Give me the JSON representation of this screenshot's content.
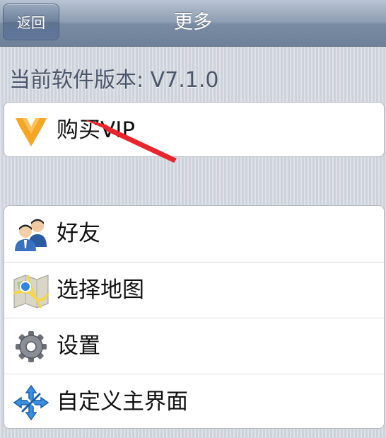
{
  "nav": {
    "back_label": "返回",
    "title": "更多"
  },
  "version": {
    "text": "当前软件版本: V7.1.0"
  },
  "vip": {
    "label": "购买VIP",
    "icon": "vip-diamond-icon"
  },
  "menu": {
    "items": [
      {
        "label": "好友",
        "icon": "friends-icon"
      },
      {
        "label": "选择地图",
        "icon": "map-icon"
      },
      {
        "label": "设置",
        "icon": "gear-icon"
      },
      {
        "label": "自定义主界面",
        "icon": "customize-arrows-icon"
      }
    ]
  },
  "colors": {
    "nav_bar": "#7a8ca4",
    "background": "#d5dae1",
    "vip_icon": "#f5a623",
    "annotation_arrow": "#e8252b"
  }
}
